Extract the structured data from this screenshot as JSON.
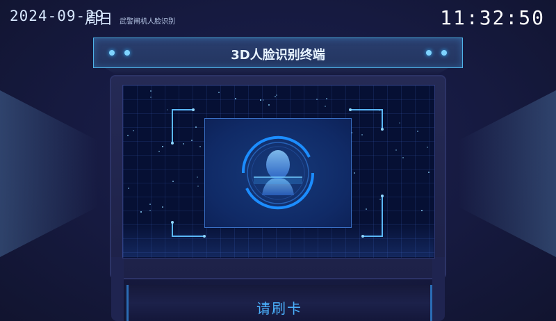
{
  "header": {
    "date": "2024-09-29",
    "weekday": "周日",
    "subtitle": "武警闸机人脸识别",
    "clock": "11:32:50"
  },
  "banner": {
    "title": "3D人脸识别终端"
  },
  "prompt": {
    "text": "请刷卡"
  },
  "icons": {
    "face_scan": "face-scan-icon"
  },
  "colors": {
    "accent": "#36b7ff",
    "background": "#161a40",
    "prompt": "#4bb2ff"
  }
}
